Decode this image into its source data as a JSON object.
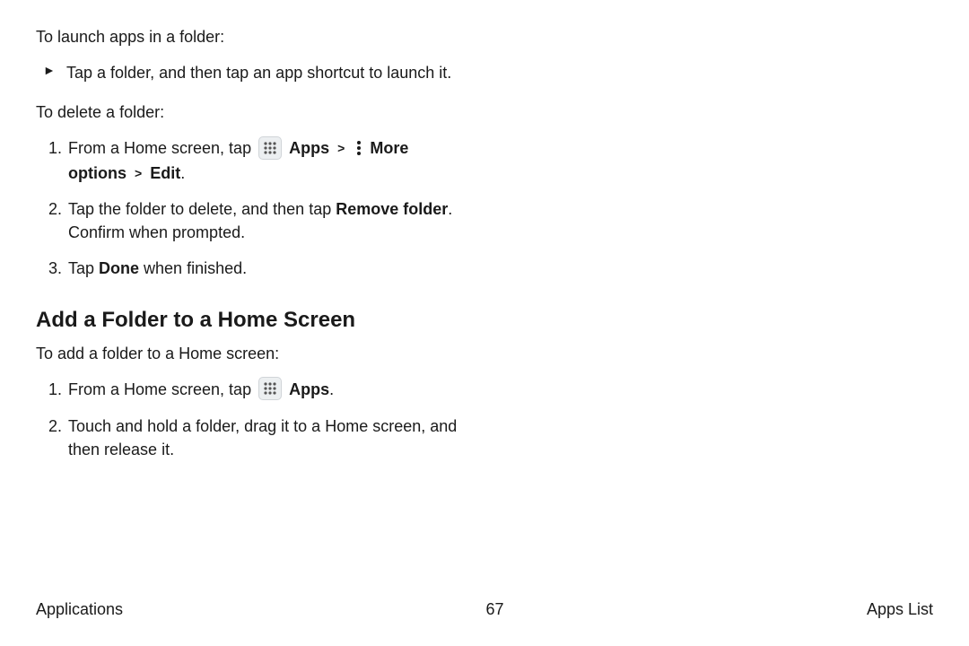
{
  "section1": {
    "intro": "To launch apps in a folder:",
    "bullet": "Tap a folder, and then tap an app shortcut to launch it."
  },
  "section2": {
    "intro": "To delete a folder:",
    "step1_a": "From a Home screen, tap ",
    "apps_label": "Apps",
    "more_options_label": "More options",
    "edit_label": "Edit",
    "step2_a": "Tap the folder to delete, and then tap ",
    "remove_folder_label": "Remove folder",
    "step2_b": ". Confirm when prompted.",
    "step3_a": "Tap ",
    "done_label": "Done",
    "step3_b": " when finished."
  },
  "section3": {
    "heading": "Add a Folder to a Home Screen",
    "intro": "To add a folder to a Home screen:",
    "step1_a": "From a Home screen, tap ",
    "apps_label": "Apps",
    "step2": "Touch and hold a folder, drag it to a Home screen, and then release it."
  },
  "footer": {
    "left": "Applications",
    "center": "67",
    "right": "Apps List"
  },
  "glyphs": {
    "caret": ">"
  }
}
